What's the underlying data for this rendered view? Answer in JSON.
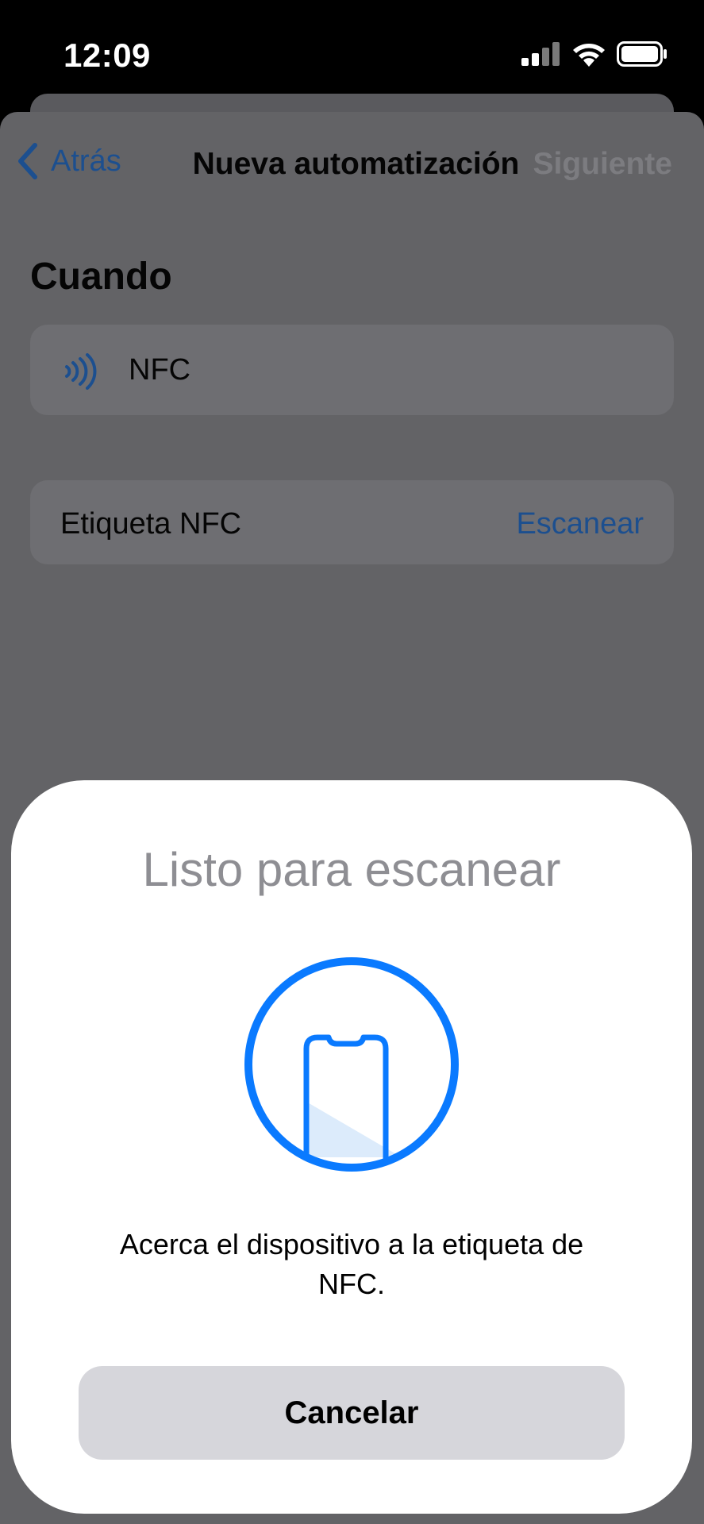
{
  "status_bar": {
    "time": "12:09",
    "icons": [
      "cellular-signal-icon",
      "wifi-icon",
      "battery-icon"
    ]
  },
  "nav": {
    "back_label": "Atrás",
    "title": "Nueva automatización",
    "next_label": "Siguiente"
  },
  "content": {
    "section_title": "Cuando",
    "trigger": {
      "icon": "nfc-icon",
      "label": "NFC"
    },
    "tag_row": {
      "label": "Etiqueta NFC",
      "action": "Escanear"
    }
  },
  "modal": {
    "title": "Listo para escanear",
    "graphic": "phone-scan-icon",
    "message": "Acerca el dispositivo a la etiqueta de NFC.",
    "cancel_label": "Cancelar"
  },
  "colors": {
    "accent": "#0a7aff",
    "dimmed_link": "#1c4f8f",
    "sheet_dimmed": "#636366",
    "cancel_bg": "#d6d6db"
  }
}
